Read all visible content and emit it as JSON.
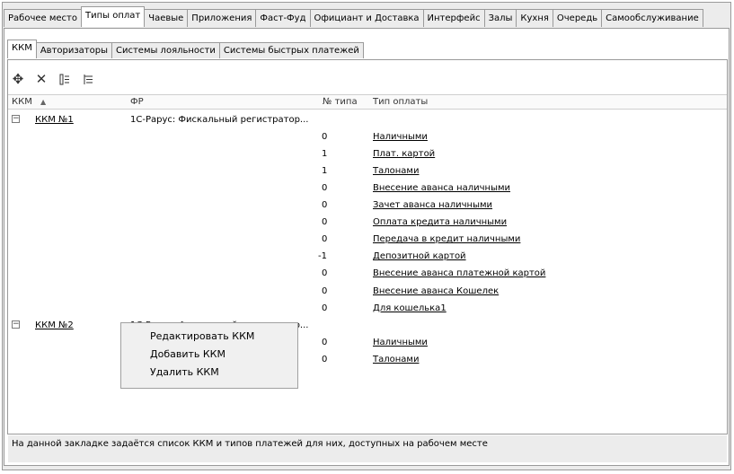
{
  "top_tabs": [
    "Рабочее место",
    "Типы оплат",
    "Чаевые",
    "Приложения",
    "Фаст-Фуд",
    "Официант и Доставка",
    "Интерфейс",
    "Залы",
    "Кухня",
    "Очередь",
    "Самообслуживание"
  ],
  "active_top_tab": "Типы оплат",
  "sub_tabs": [
    "ККМ",
    "Авторизаторы",
    "Системы лояльности",
    "Системы быстрых платежей"
  ],
  "active_sub_tab": "ККМ",
  "toolbar": {
    "add_icon": "add-icon",
    "delete_icon": "delete-icon",
    "list_icon": "list-icon",
    "tree_icon": "tree-icon"
  },
  "columns": {
    "kkm": "ККМ",
    "sort_glyph": "▲",
    "fr": "ФР",
    "type_no": "№ типа",
    "pay_type": "Тип оплаты"
  },
  "groups": [
    {
      "name": "ККМ №1",
      "fr": "1С-Рарус: Фискальный регистратор...",
      "payments": [
        {
          "num": "0",
          "name": "Наличными"
        },
        {
          "num": "1",
          "name": "Плат. картой"
        },
        {
          "num": "1",
          "name": "Талонами"
        },
        {
          "num": "0",
          "name": "Внесение аванса наличными"
        },
        {
          "num": "0",
          "name": "Зачет аванса наличными"
        },
        {
          "num": "0",
          "name": "Оплата  кредита наличными"
        },
        {
          "num": "0",
          "name": "Передача в кредит наличными"
        },
        {
          "num": "-1",
          "name": "Депозитной картой"
        },
        {
          "num": "0",
          "name": "Внесение аванса платежной картой"
        },
        {
          "num": "0",
          "name": "Внесение аванса Кошелек"
        },
        {
          "num": "0",
          "name": "Для кошелька1"
        }
      ]
    },
    {
      "name": "ККМ №2",
      "fr": "1С-Рарус: Фискальный регистратор...",
      "payments": [
        {
          "num": "0",
          "name": "Наличными"
        },
        {
          "num": "0",
          "name": "Талонами"
        }
      ]
    }
  ],
  "context_menu": [
    "Редактировать ККМ",
    "Добавить ККМ",
    "Удалить ККМ"
  ],
  "status_text": "На данной закладке задаётся список ККМ и типов платежей для них, доступных на рабочем месте"
}
